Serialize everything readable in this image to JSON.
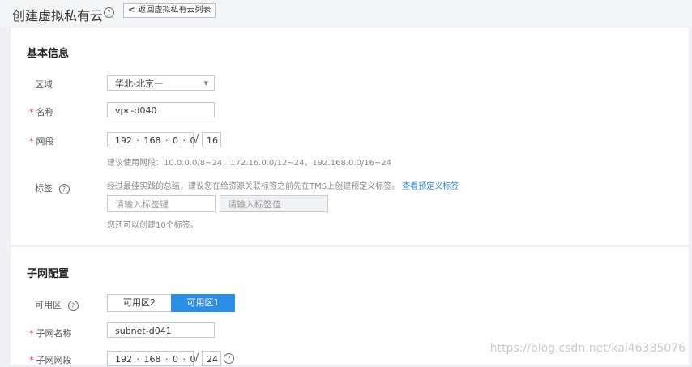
{
  "header": {
    "title": "创建虚拟私有云",
    "help_icon": "?",
    "back_label": "返回虚拟私有云列表",
    "back_icon": "<"
  },
  "basic": {
    "section_title": "基本信息",
    "region": {
      "label": "区域",
      "value": "华北-北京一"
    },
    "name": {
      "label": "名称",
      "value": "vpc-d040"
    },
    "cidr": {
      "label": "网段",
      "octets": [
        "192",
        "168",
        "0",
        "0"
      ],
      "mask": "16",
      "suggestion": "建议使用网段：10.0.0.0/8~24，172.16.0.0/12~24，192.168.0.0/16~24"
    },
    "tags": {
      "label": "标签",
      "hint": "经过最佳实践的总结，建议您在给资源关联标签之前先在TMS上创建预定义标签。",
      "hint_link": "查看预定义标签",
      "key_placeholder": "请输入标签键",
      "value_placeholder": "请输入标签值",
      "remaining": "您还可以创建10个标签。"
    }
  },
  "subnet": {
    "section_title": "子网配置",
    "az": {
      "label": "可用区",
      "options": [
        "可用区2",
        "可用区1"
      ],
      "selected": 1
    },
    "name": {
      "label": "子网名称",
      "value": "subnet-d041"
    },
    "cidr": {
      "label": "子网网段",
      "octets": [
        "192",
        "168",
        "0",
        "0"
      ],
      "mask": "24"
    }
  },
  "watermark": "https://blog.csdn.net/kai46385076",
  "colors": {
    "accent": "#2a8de6",
    "required": "#e4393c",
    "link": "#2a89d6"
  }
}
